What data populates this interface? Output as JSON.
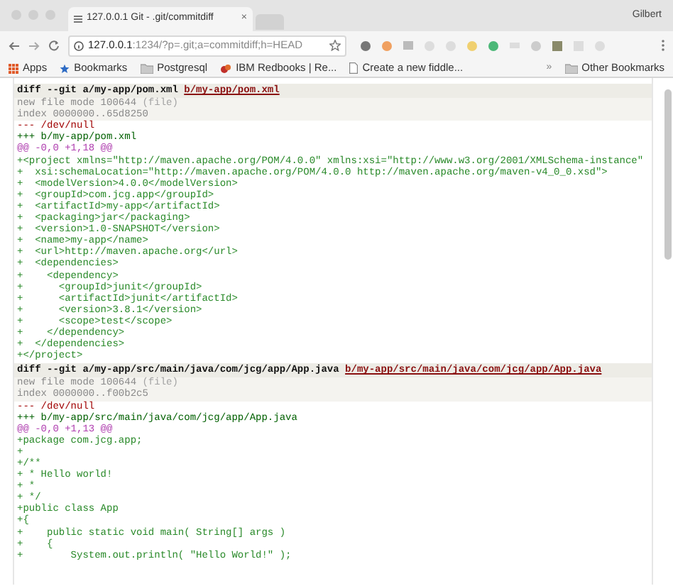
{
  "browser": {
    "tab_title": "127.0.0.1 Git - .git/commitdiff",
    "tab_close": "×",
    "profile_name": "Gilbert",
    "url_host": "127.0.0.1",
    "url_path": ":1234/?p=.git;a=commitdiff;h=HEAD",
    "bookmarks": [
      {
        "kind": "apps",
        "label": "Apps"
      },
      {
        "kind": "star",
        "label": "Bookmarks"
      },
      {
        "kind": "folder",
        "label": "Postgresql"
      },
      {
        "kind": "logo",
        "label": "IBM Redbooks | Re..."
      },
      {
        "kind": "page",
        "label": "Create a new fiddle..."
      }
    ],
    "overflow": "»",
    "other_bookmarks": "Other Bookmarks"
  },
  "diff": [
    {
      "kind": "header",
      "text": "diff --git a/my-app/pom.xml ",
      "link": "b/my-app/pom.xml"
    },
    {
      "kind": "extended",
      "text": "new file mode 100644 ",
      "note": "(file)"
    },
    {
      "kind": "extended",
      "text": "index 0000000..65d8250"
    },
    {
      "kind": "from",
      "text": "--- /dev/null"
    },
    {
      "kind": "to",
      "text": "+++ b/my-app/pom.xml"
    },
    {
      "kind": "chunk",
      "text": "@@ -0,0 +1,18 @@"
    },
    {
      "kind": "add",
      "text": "+<project xmlns=\"http://maven.apache.org/POM/4.0.0\" xmlns:xsi=\"http://www.w3.org/2001/XMLSchema-instance\""
    },
    {
      "kind": "add",
      "text": "+  xsi:schemaLocation=\"http://maven.apache.org/POM/4.0.0 http://maven.apache.org/maven-v4_0_0.xsd\">"
    },
    {
      "kind": "add",
      "text": "+  <modelVersion>4.0.0</modelVersion>"
    },
    {
      "kind": "add",
      "text": "+  <groupId>com.jcg.app</groupId>"
    },
    {
      "kind": "add",
      "text": "+  <artifactId>my-app</artifactId>"
    },
    {
      "kind": "add",
      "text": "+  <packaging>jar</packaging>"
    },
    {
      "kind": "add",
      "text": "+  <version>1.0-SNAPSHOT</version>"
    },
    {
      "kind": "add",
      "text": "+  <name>my-app</name>"
    },
    {
      "kind": "add",
      "text": "+  <url>http://maven.apache.org</url>"
    },
    {
      "kind": "add",
      "text": "+  <dependencies>"
    },
    {
      "kind": "add",
      "text": "+    <dependency>"
    },
    {
      "kind": "add",
      "text": "+      <groupId>junit</groupId>"
    },
    {
      "kind": "add",
      "text": "+      <artifactId>junit</artifactId>"
    },
    {
      "kind": "add",
      "text": "+      <version>3.8.1</version>"
    },
    {
      "kind": "add",
      "text": "+      <scope>test</scope>"
    },
    {
      "kind": "add",
      "text": "+    </dependency>"
    },
    {
      "kind": "add",
      "text": "+  </dependencies>"
    },
    {
      "kind": "add",
      "text": "+</project>"
    },
    {
      "kind": "header",
      "text": "diff --git a/my-app/src/main/java/com/jcg/app/App.java ",
      "link": "b/my-app/src/main/java/com/jcg/app/App.java"
    },
    {
      "kind": "extended",
      "text": "new file mode 100644 ",
      "note": "(file)"
    },
    {
      "kind": "extended",
      "text": "index 0000000..f00b2c5"
    },
    {
      "kind": "from",
      "text": "--- /dev/null"
    },
    {
      "kind": "to",
      "text": "+++ b/my-app/src/main/java/com/jcg/app/App.java"
    },
    {
      "kind": "chunk",
      "text": "@@ -0,0 +1,13 @@"
    },
    {
      "kind": "add",
      "text": "+package com.jcg.app;"
    },
    {
      "kind": "add",
      "text": "+"
    },
    {
      "kind": "add",
      "text": "+/**"
    },
    {
      "kind": "add",
      "text": "+ * Hello world!"
    },
    {
      "kind": "add",
      "text": "+ *"
    },
    {
      "kind": "add",
      "text": "+ */"
    },
    {
      "kind": "add",
      "text": "+public class App"
    },
    {
      "kind": "add",
      "text": "+{"
    },
    {
      "kind": "add",
      "text": "+    public static void main( String[] args )"
    },
    {
      "kind": "add",
      "text": "+    {"
    },
    {
      "kind": "add",
      "text": "+        System.out.println( \"Hello World!\" );"
    }
  ]
}
